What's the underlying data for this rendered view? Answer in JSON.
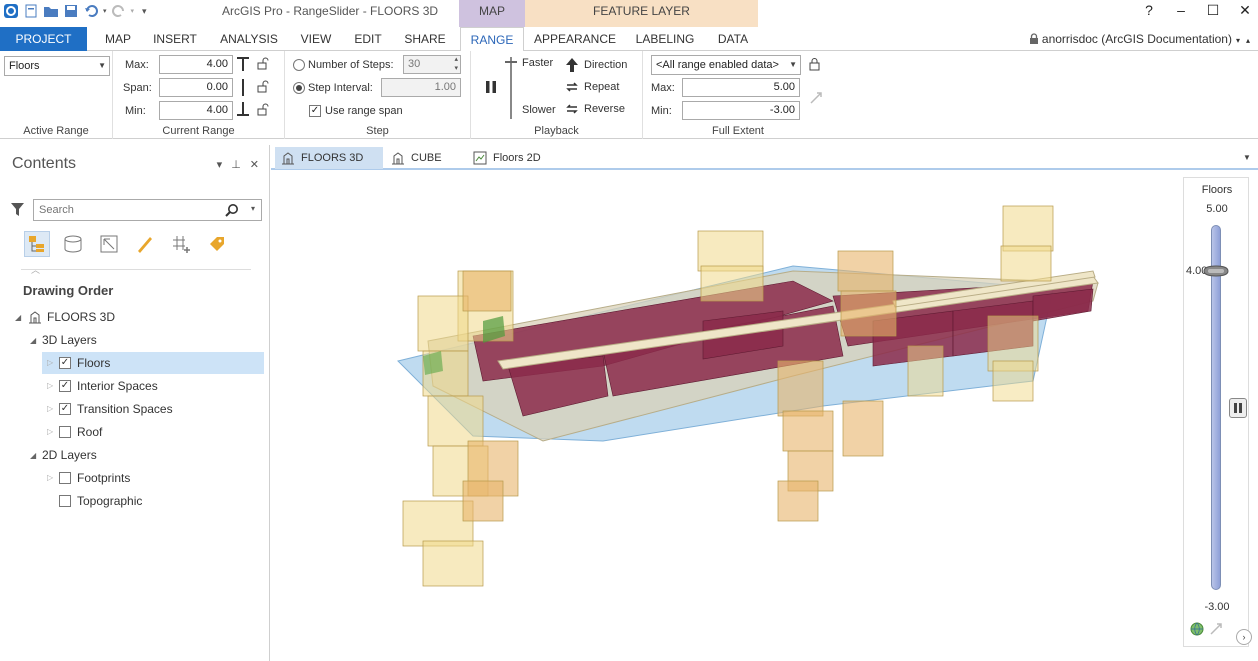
{
  "app": {
    "title": "ArcGIS Pro - RangeSlider - FLOORS 3D",
    "context_tabs": {
      "map": "MAP",
      "feature_layer": "FEATURE LAYER"
    },
    "window_controls": {
      "help": "?",
      "minimize": "–",
      "maximize": "☐",
      "close": "✕"
    },
    "user": "anorrisdoc (ArcGIS Documentation)"
  },
  "tabs": [
    {
      "label": "PROJECT"
    },
    {
      "label": "MAP"
    },
    {
      "label": "INSERT"
    },
    {
      "label": "ANALYSIS"
    },
    {
      "label": "VIEW"
    },
    {
      "label": "EDIT"
    },
    {
      "label": "SHARE"
    },
    {
      "label": "RANGE"
    },
    {
      "label": "APPEARANCE"
    },
    {
      "label": "LABELING"
    },
    {
      "label": "DATA"
    }
  ],
  "ribbon": {
    "active_range": {
      "value": "Floors",
      "label": "Active Range"
    },
    "current_range": {
      "label": "Current Range",
      "max_label": "Max:",
      "max_value": "4.00",
      "span_label": "Span:",
      "span_value": "0.00",
      "min_label": "Min:",
      "min_value": "4.00"
    },
    "step": {
      "label": "Step",
      "num_steps_label": "Number of Steps:",
      "num_steps_value": "30",
      "step_interval_label": "Step Interval:",
      "step_interval_value": "1.00",
      "use_range_span": "Use range span",
      "check_mark": "✓"
    },
    "playback": {
      "label": "Playback",
      "faster": "Faster",
      "slower": "Slower",
      "direction": "Direction",
      "repeat": "Repeat",
      "reverse": "Reverse"
    },
    "full_extent": {
      "label": "Full Extent",
      "layer_select": "<All range enabled data>",
      "max_label": "Max:",
      "max_value": "5.00",
      "min_label": "Min:",
      "min_value": "-3.00"
    }
  },
  "contents": {
    "title": "Contents",
    "pane_controls": {
      "menu": "▾",
      "pin": "⊥",
      "close": "✕"
    },
    "search_placeholder": "Search",
    "drawing_order": "Drawing Order",
    "check_mark": "✓",
    "tree": {
      "map": "FLOORS 3D",
      "group_3d": "3D Layers",
      "floors": "Floors",
      "interior": "Interior Spaces",
      "transition": "Transition Spaces",
      "roof": "Roof",
      "group_2d": "2D Layers",
      "footprints": "Footprints",
      "topographic": "Topographic"
    }
  },
  "map_tabs": [
    {
      "label": "FLOORS 3D",
      "close": "✕"
    },
    {
      "label": "CUBE"
    },
    {
      "label": "Floors 2D"
    }
  ],
  "slider": {
    "title": "Floors",
    "max": "5.00",
    "min": "-3.00",
    "current": 4.0,
    "current_label": "4.00",
    "range_min": -3.0,
    "range_max": 5.0
  },
  "colors": {
    "accent": "#1f6fc5",
    "map_context": "#cfc2df",
    "feature_context": "#f8e0c4",
    "floors_fill": "#8b2a4a",
    "transition_fill": "#f1d98a",
    "footprint_fill": "#9cc7e8"
  }
}
